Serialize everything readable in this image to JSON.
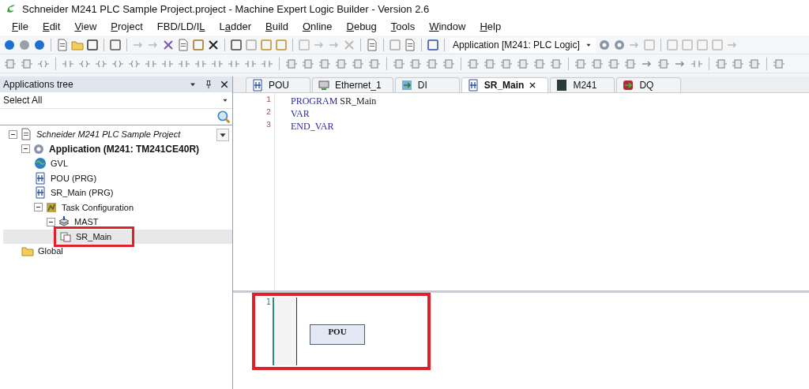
{
  "window": {
    "title": "Schneider M241 PLC Sample Project.project - Machine Expert Logic Builder - Version 2.6"
  },
  "menu": [
    {
      "key": "F",
      "after": "ile"
    },
    {
      "key": "E",
      "after": "dit"
    },
    {
      "key": "V",
      "after": "iew"
    },
    {
      "key": "P",
      "after": "roject"
    },
    {
      "before": "FBD/LD/I",
      "key": "L"
    },
    {
      "before": "L",
      "key": "a",
      "after": "dder"
    },
    {
      "key": "B",
      "after": "uild"
    },
    {
      "key": "O",
      "after": "nline"
    },
    {
      "key": "D",
      "after": "ebug"
    },
    {
      "key": "T",
      "after": "ools"
    },
    {
      "key": "W",
      "after": "indow"
    },
    {
      "key": "H",
      "after": "elp"
    }
  ],
  "toolbar": {
    "application_combo": "Application [M241: PLC Logic]"
  },
  "applications_tree": {
    "title": "Applications tree",
    "filter": "Select All",
    "nodes": [
      {
        "label": "Schneider M241 PLC Sample Project",
        "kind": "project",
        "expanded": true,
        "selected": false,
        "highlighted": false,
        "children": [
          {
            "label": "Application (M241: TM241CE40R)",
            "kind": "application",
            "expanded": true,
            "selected": false,
            "highlighted": false,
            "children": [
              {
                "label": "GVL",
                "kind": "gvl",
                "selected": false,
                "highlighted": false
              },
              {
                "label": "POU (PRG)",
                "kind": "pou",
                "selected": false,
                "highlighted": false
              },
              {
                "label": "SR_Main (PRG)",
                "kind": "pou",
                "selected": false,
                "highlighted": false
              },
              {
                "label": "Task Configuration",
                "kind": "taskconfig",
                "expanded": true,
                "selected": false,
                "highlighted": false,
                "children": [
                  {
                    "label": "MAST",
                    "kind": "task",
                    "expanded": true,
                    "selected": false,
                    "highlighted": false,
                    "children": [
                      {
                        "label": "SR_Main",
                        "kind": "call",
                        "selected": true,
                        "highlighted": true
                      }
                    ]
                  }
                ]
              }
            ]
          },
          {
            "label": "Global",
            "kind": "folder",
            "selected": false,
            "highlighted": false
          }
        ]
      }
    ]
  },
  "tabs": [
    {
      "label": "POU",
      "kind": "pou",
      "selected": false
    },
    {
      "label": "Ethernet_1",
      "kind": "network",
      "selected": false
    },
    {
      "label": "DI",
      "kind": "io",
      "selected": false
    },
    {
      "label": "SR_Main",
      "kind": "pou",
      "selected": true
    },
    {
      "label": "M241",
      "kind": "device",
      "selected": false
    },
    {
      "label": "DQ",
      "kind": "output",
      "selected": false
    }
  ],
  "declaration": [
    {
      "number": "1",
      "tokens": [
        {
          "text": "PROGRAM",
          "kind": "keyword"
        },
        {
          "text": " SR_Main",
          "kind": "plain"
        }
      ]
    },
    {
      "number": "2",
      "tokens": [
        {
          "text": "VAR",
          "kind": "keyword"
        }
      ]
    },
    {
      "number": "3",
      "tokens": [
        {
          "text": "END_VAR",
          "kind": "keyword"
        }
      ]
    }
  ],
  "networks": [
    {
      "number": "1",
      "block": "POU",
      "highlighted": true
    }
  ]
}
